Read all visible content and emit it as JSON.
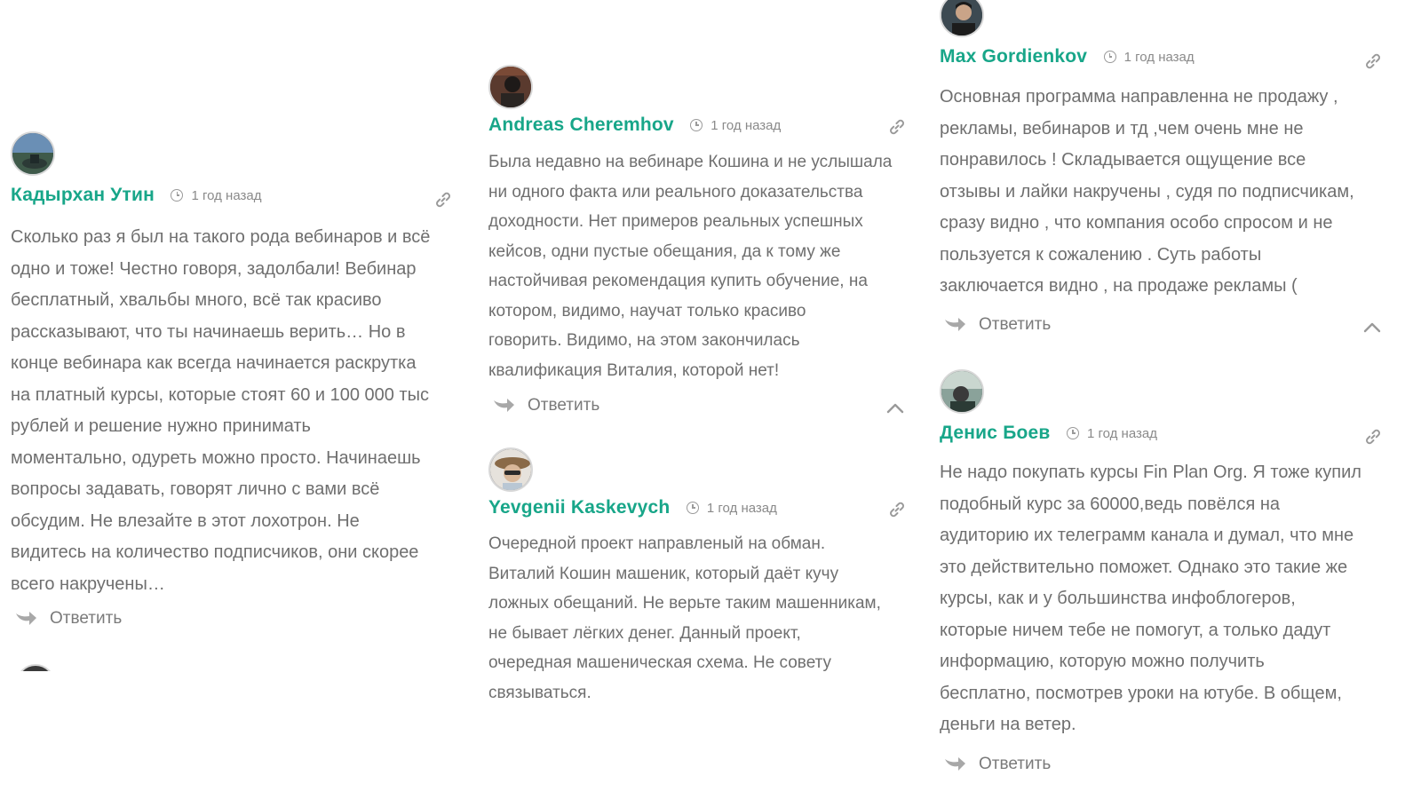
{
  "reply_label": "Ответить",
  "time_label": "1 год назад",
  "colors": {
    "name": "#18a689",
    "text": "#6f6f6f",
    "muted": "#8a8a8a"
  },
  "comments": [
    {
      "author": "Кадырхан Утин",
      "time": "1 год назад",
      "lines": [
        "Сколько раз я был на такого рода вебинаров и всё",
        "одно и тоже! Честно говоря, задолбали! Вебинар",
        "бесплатный, хвальбы много, всё так красиво",
        "рассказывают, что ты начинаешь верить… Но в",
        "конце вебинара как всегда начинается раскрутка",
        "на платный курсы, которые стоят 60 и 100 000 тыс",
        "рублей и решение нужно принимать",
        "моментально, одуреть можно просто. Начинаешь",
        "вопросы задавать, говорят лично с вами всё",
        "обсудим. Не влезайте в этот лохотрон. Не",
        "видитесь на количество подписчиков, они скорее",
        "всего накручены…"
      ],
      "reply": "Ответить"
    },
    {
      "author": "Andreas Cheremhov",
      "time": "1 год назад",
      "lines": [
        "Была недавно на вебинаре Кошина и не услышала",
        "ни одного факта или реального доказательства",
        "доходности. Нет примеров реальных успешных",
        "кейсов, одни пустые обещания, да к тому же",
        "настойчивая рекомендация купить обучение, на",
        "котором, видимо, научат только красиво",
        "говорить. Видимо, на этом закончилась",
        "квалификация Виталия, которой нет!"
      ],
      "reply": "Ответить"
    },
    {
      "author": "Yevgenii Kaskevych",
      "time": "1 год назад",
      "lines": [
        "Очередной проект направленый на обман.",
        "Виталий Кошин машеник, который даёт кучу",
        "ложных обещаний. Не верьте таким машенникам,",
        "не бывает лёгких денег. Данный проект,",
        "очередная машеническая схема. Не совету",
        "связываться."
      ]
    },
    {
      "author": "Max Gordienkov",
      "time": "1 год назад",
      "lines": [
        "Основная программа направленна не продажу ,",
        "рекламы, вебинаров и тд ,чем очень мне не",
        "понравилось ! Складывается ощущение все",
        "отзывы и лайки накручены , судя по подписчикам,",
        "сразу видно , что компания особо спросом и не",
        "пользуется к сожалению . Суть работы",
        "заключается видно , на продаже рекламы ("
      ],
      "reply": "Ответить"
    },
    {
      "author": "Денис Боев",
      "time": "1 год назад",
      "lines": [
        "Не надо покупать курсы Fin Plan Org. Я тоже купил",
        "подобный курс за 60000,ведь повёлся на",
        "аудиторию их телеграмм канала и думал, что мне",
        "это действительно поможет. Однако это такие же",
        "курсы, как и у большинства инфоблогеров,",
        "которые ничем тебе не помогут, а только дадут",
        "информацию, которую можно получить",
        "бесплатно, посмотрев уроки на ютубе. В общем,",
        "деньги на ветер."
      ],
      "reply": "Ответить"
    }
  ]
}
